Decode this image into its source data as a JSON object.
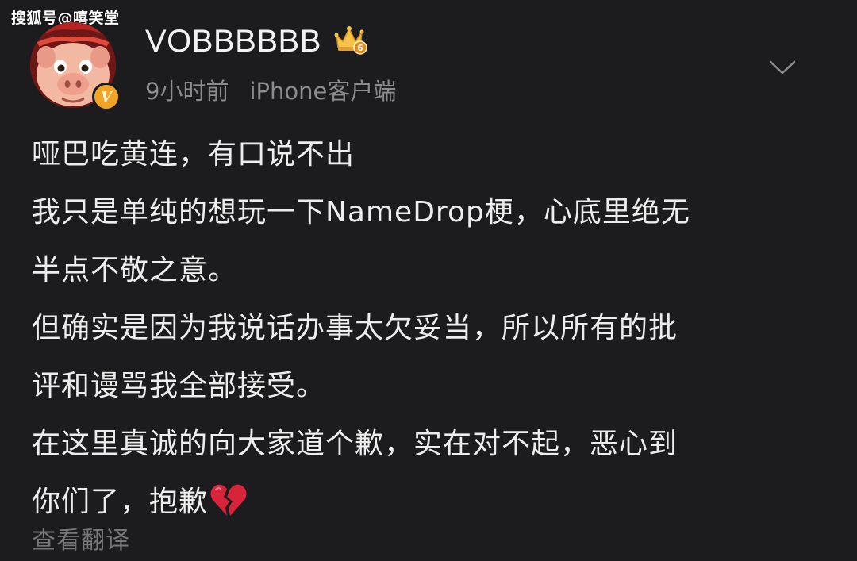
{
  "watermark": "搜狐号@嘻笑堂",
  "post": {
    "username": "VOBBBBBB",
    "vip_level": "6",
    "verified_badge": "V",
    "time": "9小时前",
    "source": "iPhone客户端",
    "content_lines": [
      "哑巴吃黄连，有口说不出",
      "我只是单纯的想玩一下NameDrop梗，心底里绝无",
      "半点不敬之意。",
      "但确实是因为我说话办事太欠妥当，所以所有的批",
      "评和谩骂我全部接受。",
      "在这里真诚的向大家道个歉，实在对不起，恶心到",
      "你们了，抱歉"
    ],
    "emoji": "broken-heart",
    "translate_label": "查看翻译"
  },
  "icons": {
    "crown": "crown-icon",
    "more": "chevron-down-icon"
  },
  "colors": {
    "background": "#1c1b1d",
    "text": "#ededed",
    "meta": "#8c8c8e",
    "verified": "#f0a526",
    "heart": "#d8243a"
  }
}
